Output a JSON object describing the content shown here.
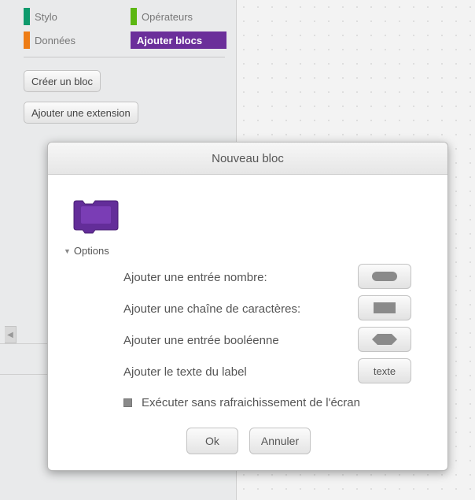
{
  "sidebar": {
    "categories": [
      {
        "label": "Stylo",
        "color": "#0e9a6c"
      },
      {
        "label": "Opérateurs",
        "color": "#5cb712"
      },
      {
        "label": "Données",
        "color": "#ee7d16"
      },
      {
        "label": "Ajouter blocs",
        "color": "#632d99",
        "selected": true
      }
    ],
    "buttons": {
      "create_block": "Créer un bloc",
      "add_extension": "Ajouter une extension"
    }
  },
  "dialog": {
    "title": "Nouveau bloc",
    "block_color": "#632d99",
    "options_label": "Options",
    "options": {
      "number_input": {
        "label": "Ajouter une entrée nombre:",
        "button_shape": "oval-input"
      },
      "string_input": {
        "label": "Ajouter une chaîne de caractères:",
        "button_shape": "rectangle-input"
      },
      "boolean_input": {
        "label": "Ajouter une entrée booléenne",
        "button_shape": "hexagon-input"
      },
      "label_text": {
        "label": "Ajouter le texte du label",
        "button_text": "texte"
      }
    },
    "run_without_refresh": {
      "label": "Exécuter sans rafraichissement de l'écran",
      "checked": false
    },
    "ok_label": "Ok",
    "cancel_label": "Annuler"
  }
}
